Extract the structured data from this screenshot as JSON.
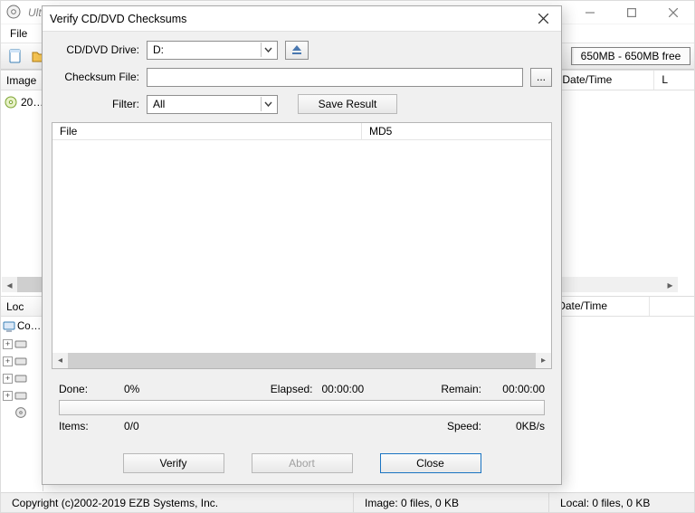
{
  "main_window": {
    "title": "UltraISO (Trial Version)",
    "menu": {
      "file": "File"
    },
    "capacity": "650MB - 650MB free",
    "upper_left_header": "Image",
    "tree_root": "20…",
    "list_headers": {
      "date_time": "Date/Time",
      "extra": "L"
    },
    "lower_left_header": "Loc",
    "lower_tree_root": "Co…"
  },
  "statusbar": {
    "copyright": "Copyright (c)2002-2019 EZB Systems, Inc.",
    "image": "Image: 0 files, 0 KB",
    "local": "Local: 0 files, 0 KB"
  },
  "dialog": {
    "title": "Verify CD/DVD Checksums",
    "labels": {
      "drive": "CD/DVD Drive:",
      "checksum_file": "Checksum File:",
      "filter": "Filter:"
    },
    "drive_value": "D:",
    "checksum_value": "",
    "filter_value": "All",
    "browse_label": "...",
    "save_result": "Save Result",
    "panel_headers": {
      "file": "File",
      "md5": "MD5"
    },
    "stats": {
      "done_label": "Done:",
      "done_value": "0%",
      "elapsed_label": "Elapsed:",
      "elapsed_value": "00:00:00",
      "remain_label": "Remain:",
      "remain_value": "00:00:00",
      "items_label": "Items:",
      "items_value": "0/0",
      "speed_label": "Speed:",
      "speed_value": "0KB/s"
    },
    "buttons": {
      "verify": "Verify",
      "abort": "Abort",
      "close": "Close"
    }
  },
  "icons": {
    "cd": "disc-icon"
  }
}
